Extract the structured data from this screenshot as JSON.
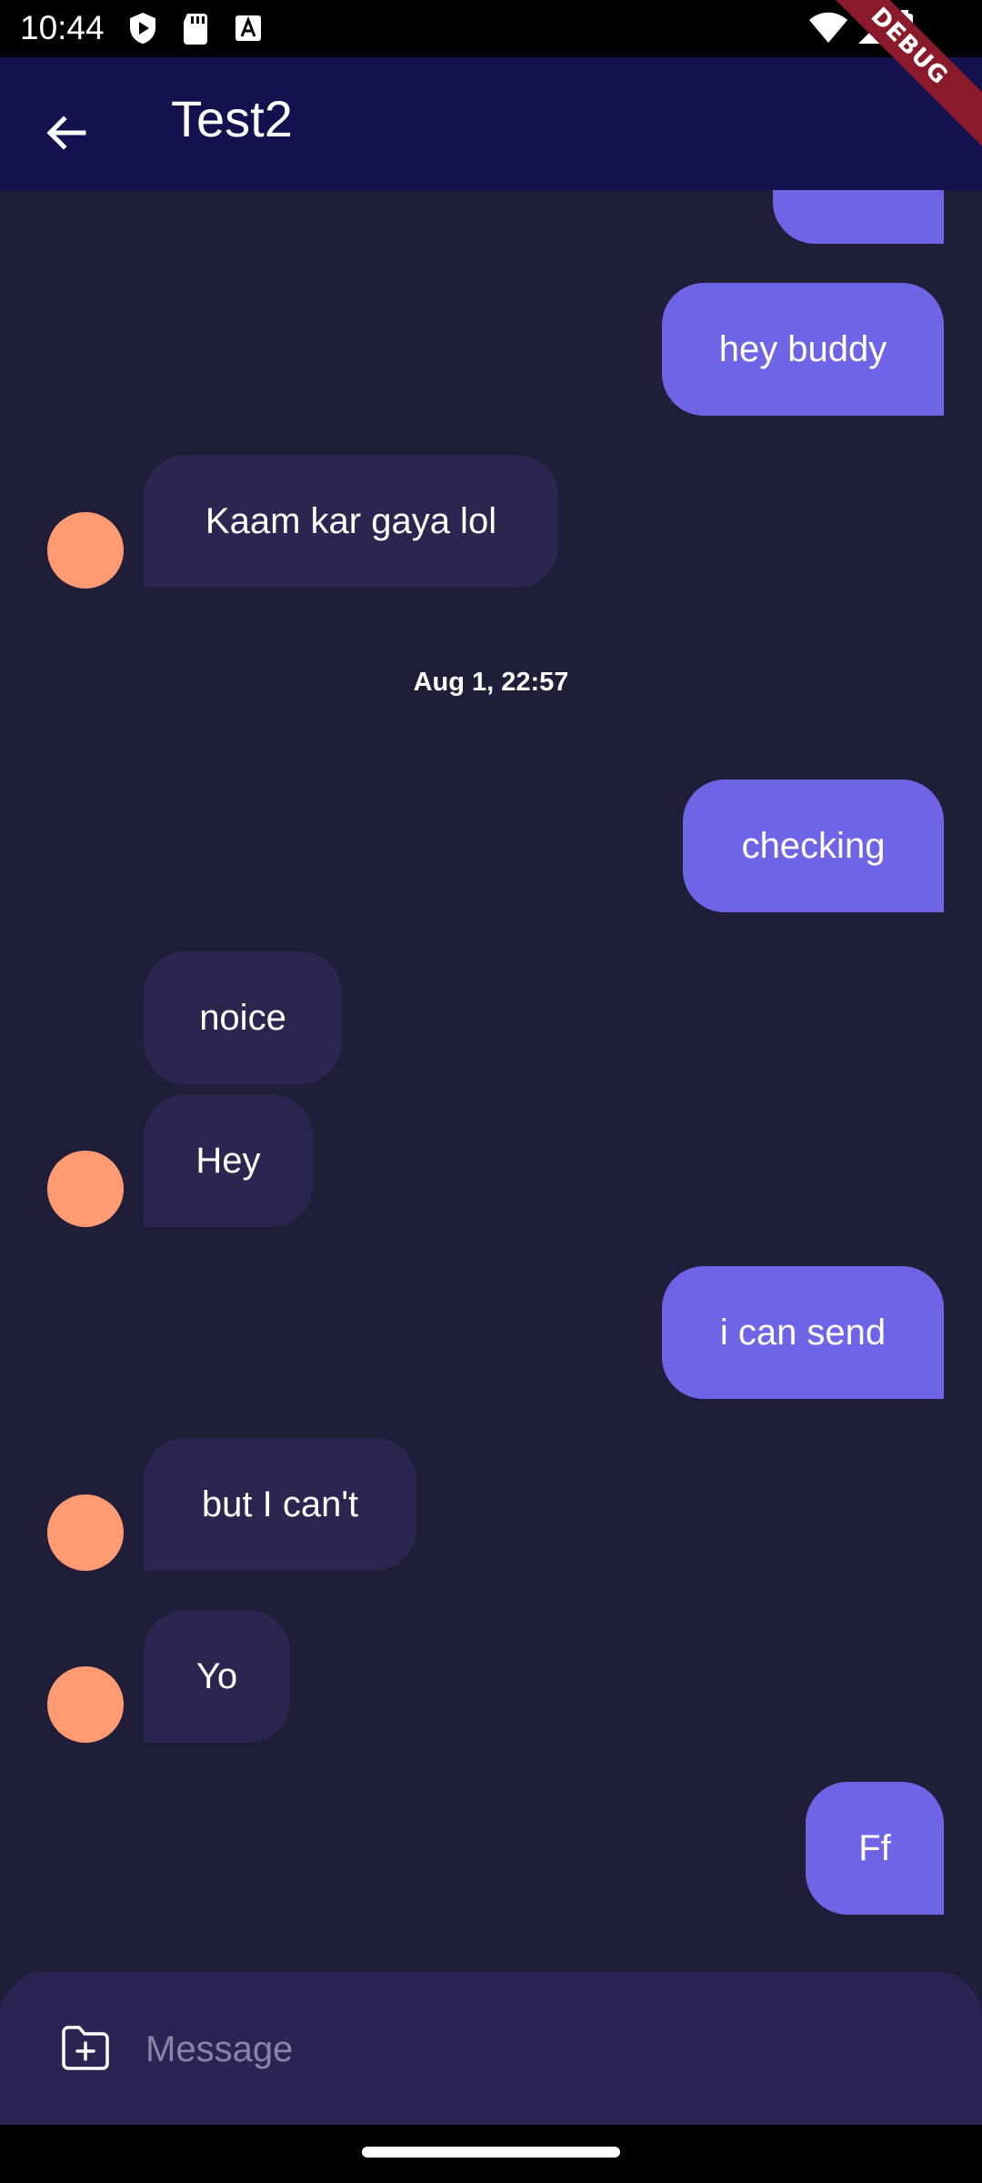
{
  "status_bar": {
    "time": "10:44"
  },
  "debug_banner": "DEBUG",
  "app_bar": {
    "title": "Test2",
    "back_icon": "arrow-left-icon"
  },
  "messages": [
    {
      "text": "",
      "type": "sent"
    },
    {
      "text": "hey buddy",
      "type": "sent"
    },
    {
      "text": "Kaam kar gaya lol",
      "type": "received"
    },
    {
      "text": "checking",
      "type": "sent"
    },
    {
      "text": "noice",
      "type": "received"
    },
    {
      "text": "Hey",
      "type": "received"
    },
    {
      "text": "i can send",
      "type": "sent"
    },
    {
      "text": "but I can't",
      "type": "received"
    },
    {
      "text": "Yo",
      "type": "received"
    },
    {
      "text": "Ff",
      "type": "sent"
    }
  ],
  "date_separator": "Aug 1, 22:57",
  "input": {
    "placeholder": "Message",
    "attach_icon": "folder-add-icon"
  },
  "colors": {
    "background": "#1f1d37",
    "app_bar": "#14124e",
    "sent_bubble": "#7064e6",
    "received_bubble": "#2c2550",
    "avatar": "#ff9b72",
    "input_bar": "#2b2352"
  }
}
